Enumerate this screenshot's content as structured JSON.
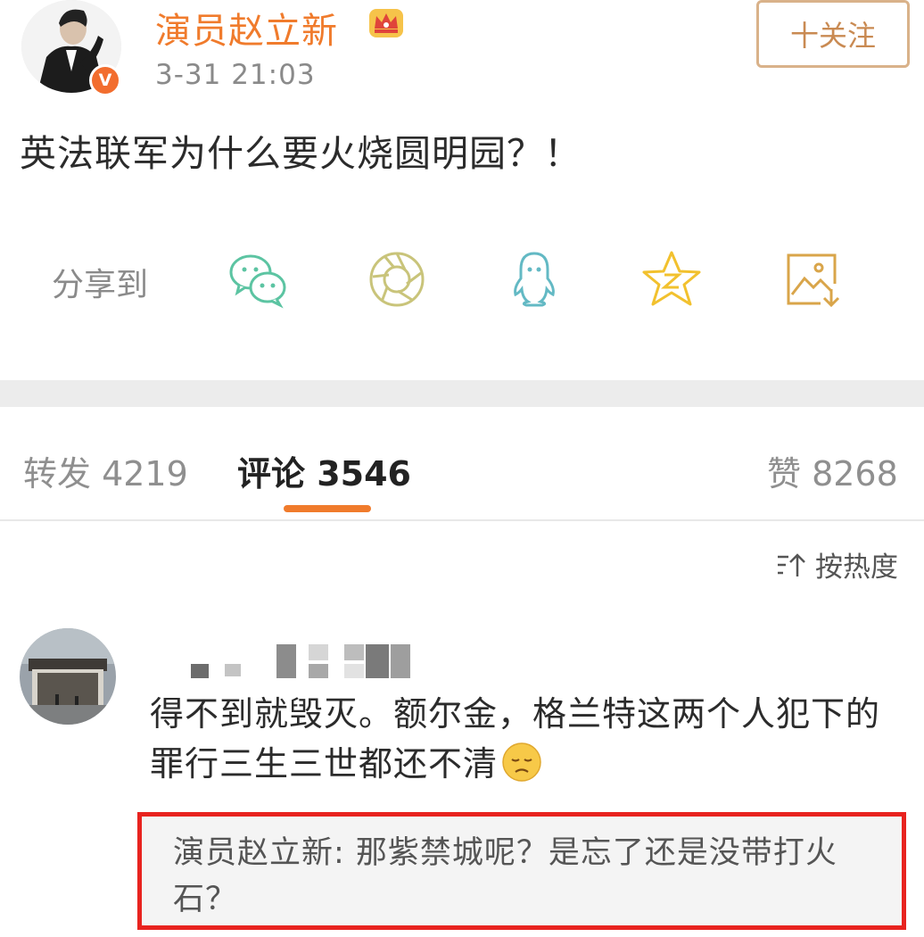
{
  "post": {
    "author": "演员赵立新",
    "timestamp": "3-31 21:03",
    "follow_label": "十关注",
    "text": "英法联军为什么要火烧圆明园？！",
    "verified_badge": "V",
    "icons": {
      "crown": "crown-icon",
      "verified": "verified-badge-icon"
    }
  },
  "share": {
    "label": "分享到",
    "targets": [
      "wechat-icon",
      "moments-icon",
      "qq-icon",
      "qzone-icon",
      "save-image-icon"
    ]
  },
  "tabs": {
    "repost": "转发 4219",
    "comments": "评论 3546",
    "likes": "赞 8268",
    "active": "comments"
  },
  "sort": {
    "label": "按热度",
    "icon": "sort-icon"
  },
  "comment": {
    "text": "得不到就毁灭。额尔金，格兰特这两个人犯下的罪行三生三世都还不清",
    "emoji": "sad-face-emoji",
    "reply": "演员赵立新: 那紫禁城呢？是忘了还是没带打火石？"
  },
  "colors": {
    "brand_orange": "#f07b2c",
    "highlight_red": "#e8231f",
    "follow_border": "#d9b28a"
  }
}
